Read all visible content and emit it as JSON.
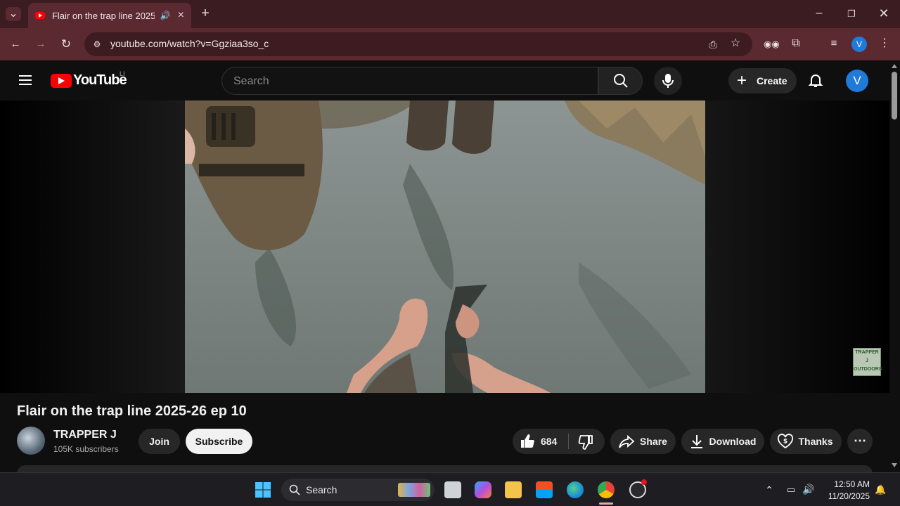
{
  "browser": {
    "tab_title": "Flair on the trap line 2025-26 ep 10",
    "url": "youtube.com/watch?v=Ggziaa3so_c",
    "profile_initial": "V"
  },
  "youtube": {
    "logo_text": "YouTube",
    "country_code": "LI",
    "search_placeholder": "Search",
    "create_label": "Create",
    "avatar_initial": "V"
  },
  "player": {
    "watermark_lines": [
      "TRAPPER",
      "J",
      "OUTDOORS"
    ]
  },
  "video": {
    "title": "Flair on the trap line 2025-26 ep 10",
    "channel_name": "TRAPPER J",
    "subscribers": "105K subscribers",
    "join_label": "Join",
    "subscribe_label": "Subscribe",
    "like_count": "684",
    "share_label": "Share",
    "download_label": "Download",
    "thanks_label": "Thanks"
  },
  "taskbar": {
    "search_label": "Search",
    "time": "12:50 AM",
    "date": "11/20/2025"
  },
  "colors": {
    "youtube_red": "#ff0000",
    "chrome_frame": "#3a1c21",
    "chrome_toolbar": "#5a2a30",
    "page_bg": "#0f0f0f",
    "pill_bg": "#272727",
    "avatar_blue": "#1f7ad8"
  }
}
